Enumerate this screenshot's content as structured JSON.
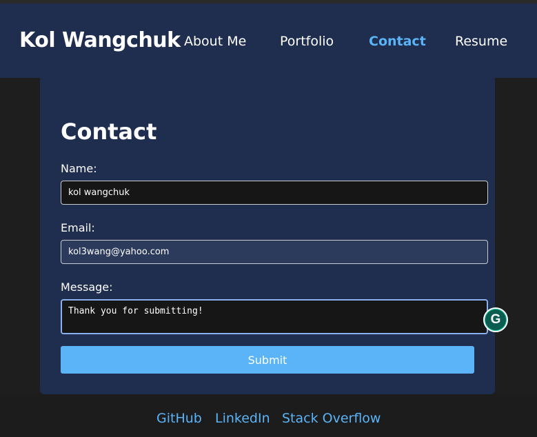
{
  "header": {
    "brand": "Kol Wangchuk",
    "nav": [
      {
        "label": "About Me",
        "active": false
      },
      {
        "label": "Portfolio",
        "active": false
      },
      {
        "label": "Contact",
        "active": true
      },
      {
        "label": "Resume",
        "active": false
      }
    ]
  },
  "contact": {
    "title": "Contact",
    "name_label": "Name:",
    "name_value": "kol wangchuk",
    "email_label": "Email:",
    "email_value": "kol3wang@yahoo.com",
    "message_label": "Message:",
    "message_value": "Thank you for submitting!",
    "submit_label": "Submit"
  },
  "extension": {
    "icon": "grammarly-icon",
    "glyph": "G"
  },
  "footer": {
    "links": [
      "GitHub",
      "LinkedIn",
      "Stack Overflow"
    ]
  },
  "colors": {
    "accent": "#5ab4f7",
    "header_bg": "#1f2d4e",
    "page_bg": "#1e1e1e"
  }
}
